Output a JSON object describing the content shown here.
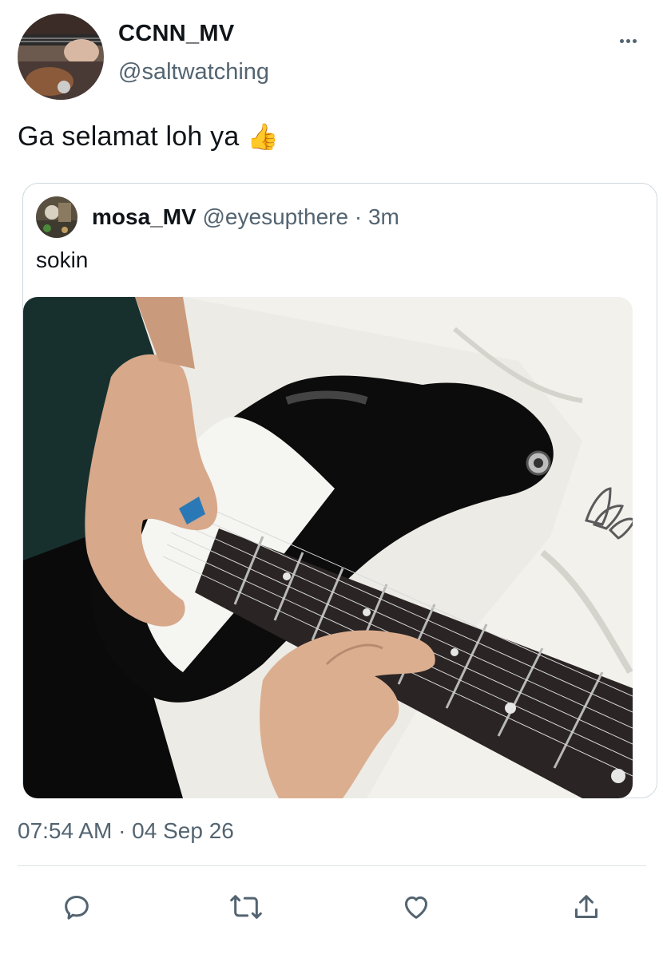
{
  "tweet": {
    "display_name": "CCNN_MV",
    "handle": "@saltwatching",
    "text": "Ga selamat loh ya",
    "emoji": "👍",
    "timestamp": "07:54 AM · 04 Sep 26"
  },
  "quoted": {
    "display_name": "mosa_MV",
    "handle": "@eyesupthere",
    "separator": "·",
    "time_ago": "3m",
    "text": "sokin"
  },
  "icons": {
    "more": "more-horizontal-icon",
    "reply": "reply-icon",
    "retweet": "retweet-icon",
    "like": "heart-icon",
    "share": "share-icon"
  },
  "colors": {
    "text": "#0f1419",
    "secondary": "#536471",
    "border": "#cfd9de"
  }
}
